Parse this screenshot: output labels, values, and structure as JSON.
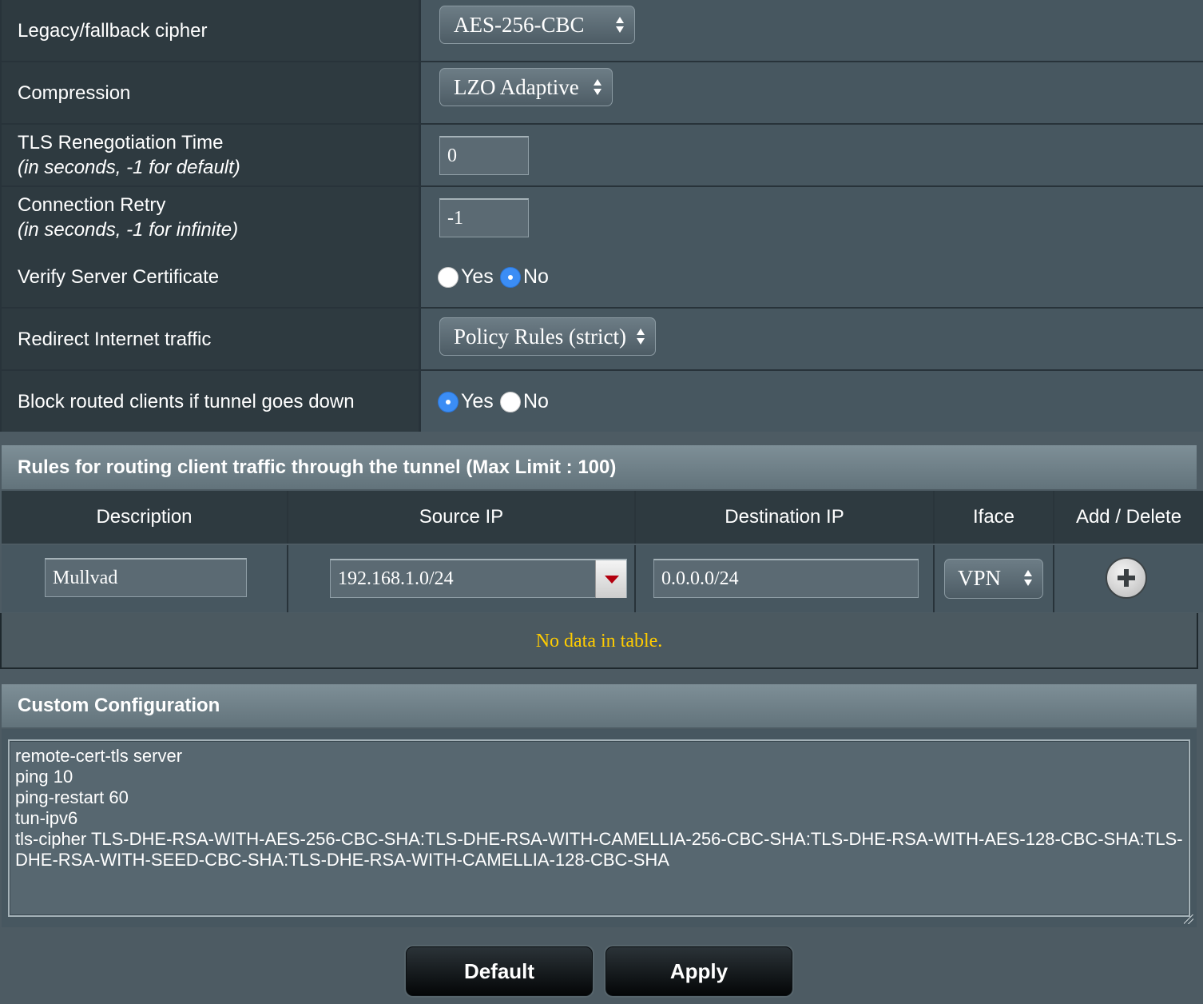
{
  "settings": {
    "cipher": {
      "label": "Legacy/fallback cipher",
      "value": "AES-256-CBC"
    },
    "compression": {
      "label": "Compression",
      "value": "LZO Adaptive"
    },
    "tls_reneg": {
      "label": "TLS Renegotiation Time",
      "sublabel": "(in seconds, -1 for default)",
      "value": "0"
    },
    "conn_retry": {
      "label": "Connection Retry",
      "sublabel": "(in seconds, -1 for infinite)",
      "value": "-1"
    },
    "verify_cert": {
      "label": "Verify Server Certificate",
      "yes": "Yes",
      "no": "No",
      "selected": "No"
    },
    "redirect": {
      "label": "Redirect Internet traffic",
      "value": "Policy Rules (strict)"
    },
    "block_clients": {
      "label": "Block routed clients if tunnel goes down",
      "yes": "Yes",
      "no": "No",
      "selected": "Yes"
    }
  },
  "rules": {
    "title": "Rules for routing client traffic through the tunnel (Max Limit : 100)",
    "columns": [
      "Description",
      "Source IP",
      "Destination IP",
      "Iface",
      "Add / Delete"
    ],
    "input_row": {
      "description": "Mullvad",
      "source_ip": "192.168.1.0/24",
      "destination_ip": "0.0.0.0/24",
      "iface": "VPN"
    },
    "empty_message": "No data in table."
  },
  "custom": {
    "title": "Custom Configuration",
    "text": "remote-cert-tls server\nping 10\nping-restart 60\ntun-ipv6\ntls-cipher TLS-DHE-RSA-WITH-AES-256-CBC-SHA:TLS-DHE-RSA-WITH-CAMELLIA-256-CBC-SHA:TLS-DHE-RSA-WITH-AES-128-CBC-SHA:TLS-DHE-RSA-WITH-SEED-CBC-SHA:TLS-DHE-RSA-WITH-CAMELLIA-128-CBC-SHA"
  },
  "buttons": {
    "default": "Default",
    "apply": "Apply"
  },
  "icons": {
    "select_arrows": "up-down-arrows-icon",
    "dropdown": "caret-down-icon",
    "add": "plus-circle-icon"
  },
  "colors": {
    "accent": "#3b8df5",
    "notice": "#ffcc00",
    "dropdown_caret": "#b3000f"
  }
}
